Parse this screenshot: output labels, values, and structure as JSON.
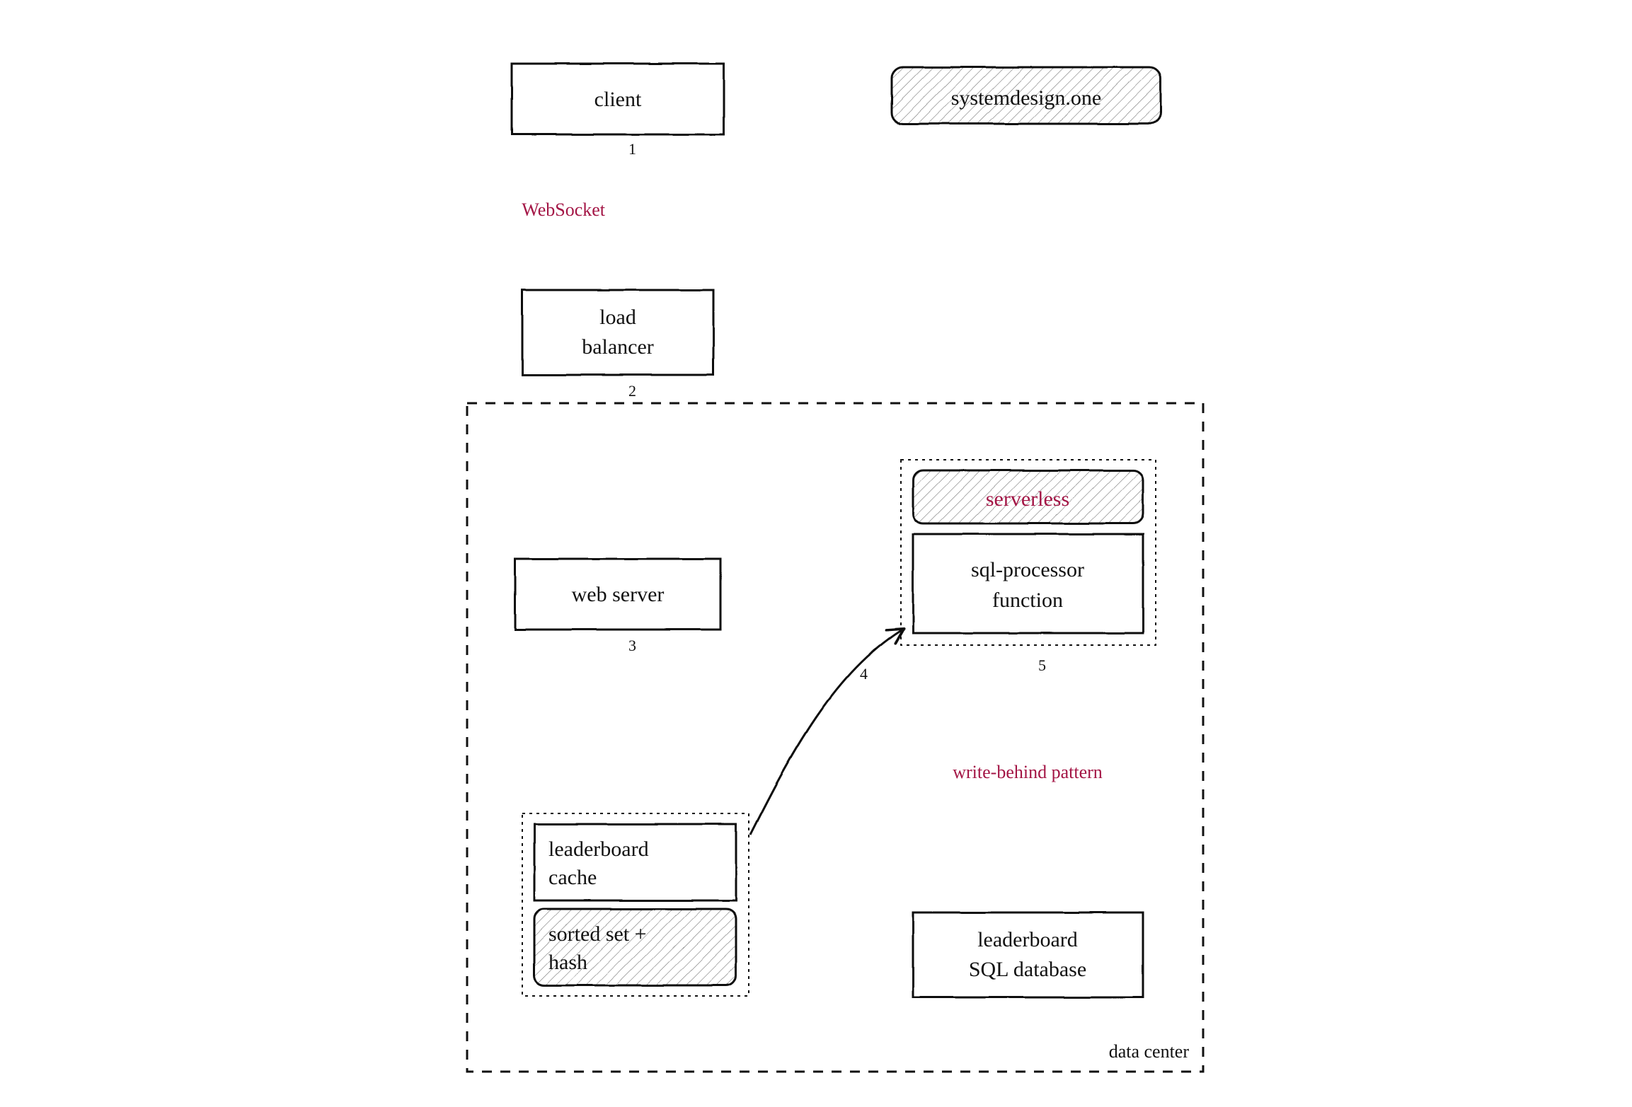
{
  "watermark": "systemdesign.one",
  "container_label": "data center",
  "nodes": {
    "client": "client",
    "load_balancer_l1": "load",
    "load_balancer_l2": "balancer",
    "web_server": "web server",
    "leaderboard_cache_l1": "leaderboard",
    "leaderboard_cache_l2": "cache",
    "sorted_set_l1": "sorted set +",
    "sorted_set_l2": "hash",
    "serverless": "serverless",
    "sql_processor_l1": "sql-processor",
    "sql_processor_l2": "function",
    "leaderboard_db_l1": "leaderboard",
    "leaderboard_db_l2": "SQL database"
  },
  "edges": {
    "e1": "1",
    "e2": "2",
    "e3": "3",
    "e4": "4",
    "e5": "5"
  },
  "annotations": {
    "websocket": "WebSocket",
    "write_behind": "write-behind pattern"
  }
}
